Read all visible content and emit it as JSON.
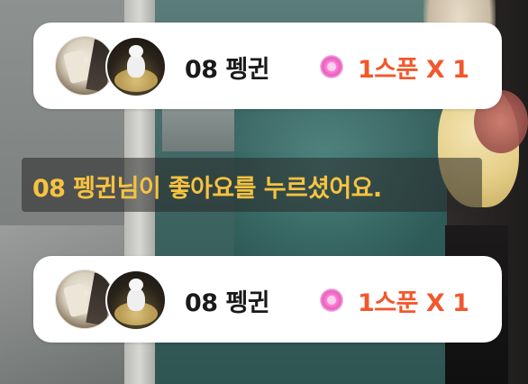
{
  "gift_events": [
    {
      "nickname": "08 펭귄",
      "gift_icon": "spoon-icon",
      "gift_text": "1스푼 X 1"
    },
    {
      "nickname": "08 펭귄",
      "gift_icon": "spoon-icon",
      "gift_text": "1스푼 X 1"
    }
  ],
  "like_notice": {
    "text": "08 펭귄님이 좋아요를 누르셨어요."
  },
  "colors": {
    "gift_text": "#f1582d",
    "like_text": "#f6c340",
    "card_background": "#ffffff",
    "nickname_text": "#1a1a1a"
  }
}
